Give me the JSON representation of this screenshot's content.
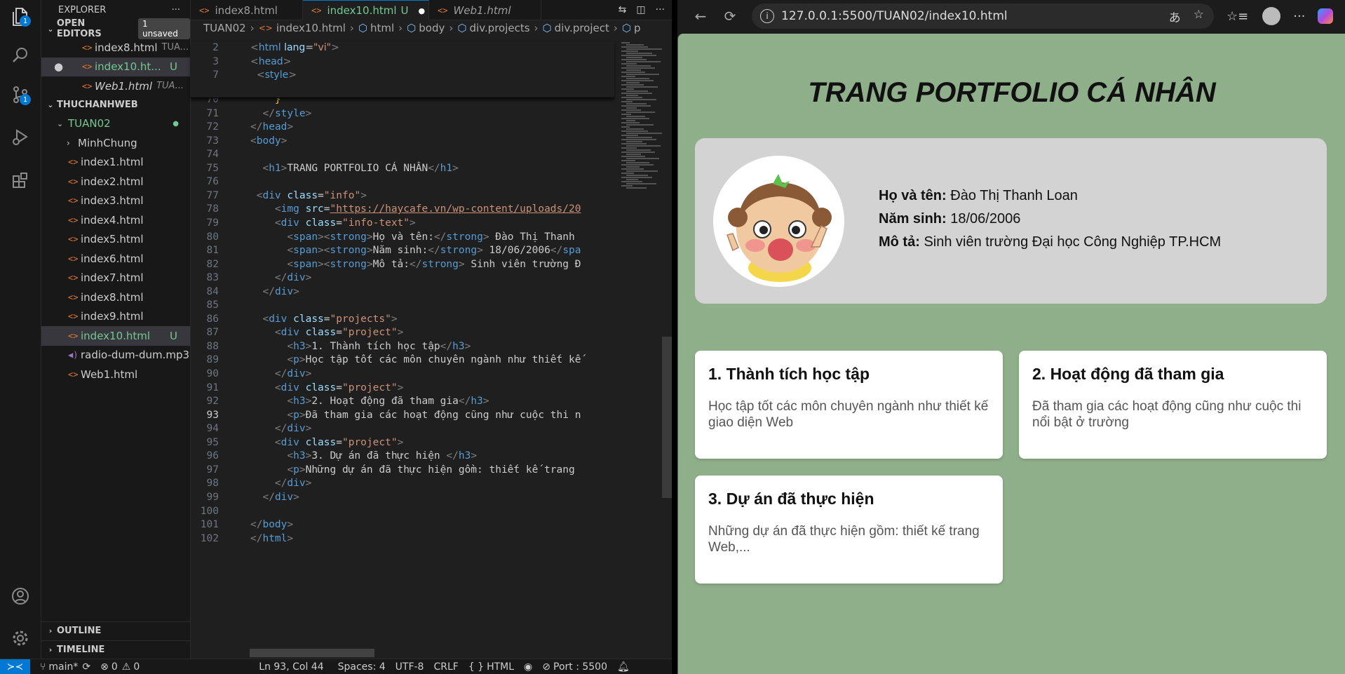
{
  "explorer": {
    "title": "EXPLORER",
    "more": "···",
    "open_editors": {
      "label": "OPEN EDITORS",
      "badge": "1 unsaved",
      "items": [
        {
          "name": "index8.html",
          "path": "TUA..."
        },
        {
          "name": "index10.ht...",
          "status": "U"
        },
        {
          "name": "Web1.html",
          "path": "TUA..."
        }
      ]
    },
    "workspace": "THUCHANHWEB",
    "folder": "TUAN02",
    "tree": [
      {
        "name": "MinhChung",
        "kind": "folder"
      },
      {
        "name": "index1.html"
      },
      {
        "name": "index2.html"
      },
      {
        "name": "index3.html"
      },
      {
        "name": "index4.html"
      },
      {
        "name": "index5.html"
      },
      {
        "name": "index6.html"
      },
      {
        "name": "index7.html"
      },
      {
        "name": "index8.html"
      },
      {
        "name": "index9.html"
      },
      {
        "name": "index10.html",
        "status": "U"
      },
      {
        "name": "radio-dum-dum.mp3",
        "kind": "audio"
      },
      {
        "name": "Web1.html"
      }
    ],
    "outline": "OUTLINE",
    "timeline": "TIMELINE"
  },
  "tabs": [
    {
      "label": "index8.html"
    },
    {
      "label": "index10.html",
      "status": "U"
    },
    {
      "label": "Web1.html"
    }
  ],
  "breadcrumbs": [
    "TUAN02",
    "index10.html",
    "html",
    "body",
    "div.projects",
    "div.project",
    "p"
  ],
  "code": {
    "sticky": [
      {
        "n": "2",
        "t": "<html lang=\"vi\">"
      },
      {
        "n": "3",
        "t": "<head>"
      },
      {
        "n": "7",
        "t": "  <style>"
      }
    ],
    "lines": [
      {
        "n": "70",
        "t": "    }"
      },
      {
        "n": "71",
        "t": "  </style>"
      },
      {
        "n": "72",
        "t": "</head>"
      },
      {
        "n": "73",
        "t": "<body>"
      },
      {
        "n": "74",
        "t": ""
      },
      {
        "n": "75",
        "t": "  <h1>TRANG PORTFOLIO CÁ NHÂN</h1>"
      },
      {
        "n": "76",
        "t": ""
      },
      {
        "n": "77",
        "t": " <div class=\"info\">"
      },
      {
        "n": "78",
        "t": "    <img src=\"https://haycafe.vn/wp-content/uploads/20"
      },
      {
        "n": "79",
        "t": "    <div class=\"info-text\">"
      },
      {
        "n": "80",
        "t": "      <span><strong>Họ và tên:</strong> Đào Thị Thanh"
      },
      {
        "n": "81",
        "t": "      <span><strong>Năm sinh:</strong> 18/06/2006</spa"
      },
      {
        "n": "82",
        "t": "      <span><strong>Mô tả:</strong> Sinh viên trường Đ"
      },
      {
        "n": "83",
        "t": "    </div>"
      },
      {
        "n": "84",
        "t": "  </div>"
      },
      {
        "n": "85",
        "t": ""
      },
      {
        "n": "86",
        "t": "  <div class=\"projects\">"
      },
      {
        "n": "87",
        "t": "    <div class=\"project\">"
      },
      {
        "n": "88",
        "t": "      <h3>1. Thành tích học tập</h3>"
      },
      {
        "n": "89",
        "t": "      <p>Học tập tốt các môn chuyên ngành như thiết kế"
      },
      {
        "n": "90",
        "t": "    </div>"
      },
      {
        "n": "91",
        "t": "    <div class=\"project\">"
      },
      {
        "n": "92",
        "t": "      <h3>2. Hoạt động đã tham gia</h3>"
      },
      {
        "n": "93",
        "t": "      <p>Đã tham gia các hoạt động cũng như cuộc thi n"
      },
      {
        "n": "94",
        "t": "    </div>"
      },
      {
        "n": "95",
        "t": "    <div class=\"project\">"
      },
      {
        "n": "96",
        "t": "      <h3>3. Dự án đã thực hiện </h3>"
      },
      {
        "n": "97",
        "t": "      <p>Những dự án đã thực hiện gồm: thiết kế trang"
      },
      {
        "n": "98",
        "t": "    </div>"
      },
      {
        "n": "99",
        "t": "  </div>"
      },
      {
        "n": "100",
        "t": ""
      },
      {
        "n": "101",
        "t": "</body>"
      },
      {
        "n": "102",
        "t": "</html>"
      }
    ],
    "current_line": "93"
  },
  "status": {
    "branch": "main*",
    "errors": "0",
    "warnings": "0",
    "cursor": "Ln 93, Col 44",
    "spaces": "Spaces: 4",
    "encoding": "UTF-8",
    "eol": "CRLF",
    "language": "HTML",
    "port": "Port : 5500"
  },
  "browser": {
    "url": "127.0.0.1:5500/TUAN02/index10.html"
  },
  "page": {
    "title": "TRANG PORTFOLIO CÁ NHÂN",
    "info": {
      "name_label": "Họ và tên:",
      "name": "Đào Thị Thanh Loan",
      "birth_label": "Năm sinh:",
      "birth": "18/06/2006",
      "desc_label": "Mô tả:",
      "desc": "Sinh viên trường Đại học Công Nghiệp TP.HCM"
    },
    "projects": [
      {
        "title": "1. Thành tích học tập",
        "text": "Học tập tốt các môn chuyên ngành như thiết kế giao diện Web"
      },
      {
        "title": "2. Hoạt động đã tham gia",
        "text": "Đã tham gia các hoạt động cũng như cuộc thi nổi bật ở trường"
      },
      {
        "title": "3. Dự án đã thực hiện",
        "text": "Những dự án đã thực hiện gồm: thiết kế trang Web,..."
      }
    ]
  },
  "colors": {
    "accent": "#0078d4",
    "page_bg": "#8faf8a",
    "untracked": "#73c991"
  }
}
